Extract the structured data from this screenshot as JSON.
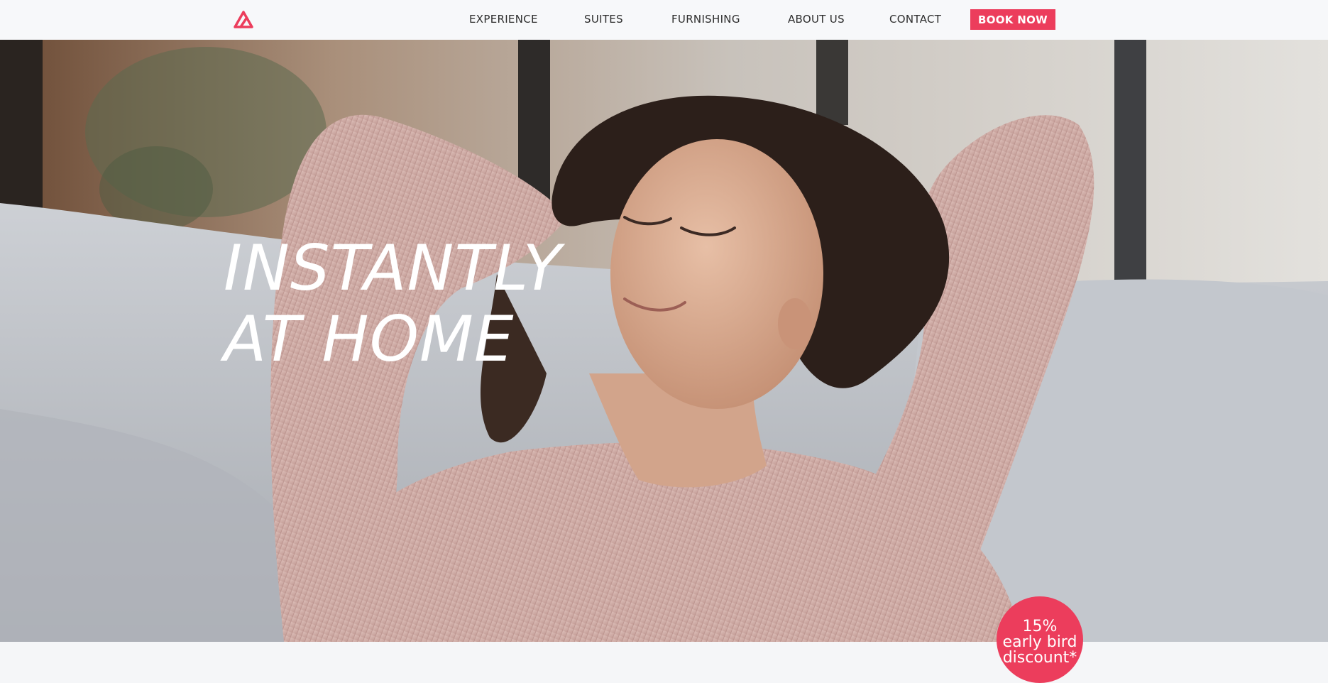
{
  "brand": {
    "logo_icon": "triangle-logo-icon",
    "accent_color": "#ec3d5c"
  },
  "nav": {
    "items": [
      {
        "label": "EXPERIENCE"
      },
      {
        "label": "SUITES"
      },
      {
        "label": "FURNISHING"
      },
      {
        "label": "ABOUT US"
      },
      {
        "label": "CONTACT"
      }
    ],
    "cta_label": "BOOK NOW"
  },
  "hero": {
    "image_subject": "woman relaxing on a grey sofa",
    "title_line1": "INSTANTLY",
    "title_line2": "AT HOME"
  },
  "promo": {
    "line1": "15%",
    "line2": "early bird",
    "line3": "discount*"
  }
}
